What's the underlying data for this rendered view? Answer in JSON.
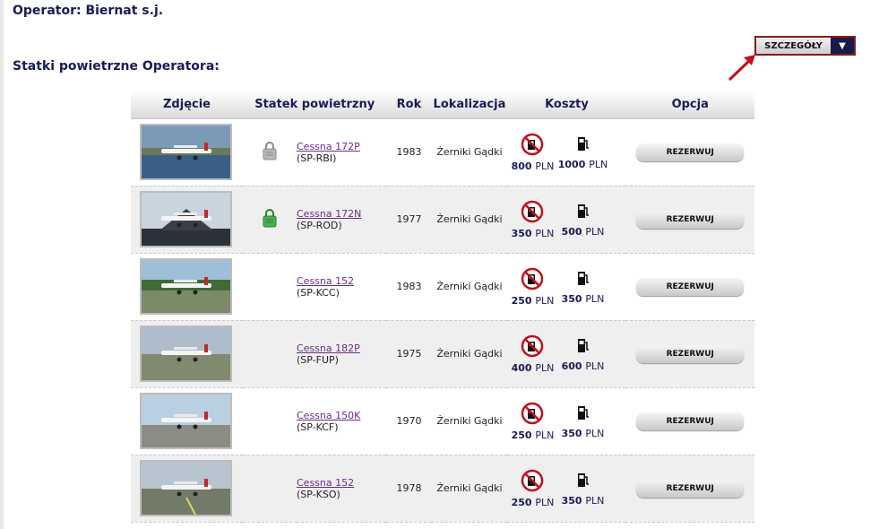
{
  "operator_title": "Operator: Biernat s.j.",
  "section_title": "Statki powietrzne Operatora:",
  "details_button": "SZCZEGÓŁY",
  "details_arrow": "▼",
  "headers": [
    "Zdjęcie",
    "Statek powietrzny",
    "Rok",
    "Lokalizacja",
    "Koszty",
    "Opcja"
  ],
  "currency": "PLN",
  "reserve_label": "REZERWUJ",
  "rows": [
    {
      "model": "Cessna 172P",
      "reg": "(SP-RBI)",
      "year": "1983",
      "location": "Żerniki Gądki",
      "cost_dry": "800",
      "cost_wet": "1000",
      "lock": "grey",
      "photo": "seaplane"
    },
    {
      "model": "Cessna 172N",
      "reg": "(SP-ROD)",
      "year": "1977",
      "location": "Żerniki Gądki",
      "cost_dry": "350",
      "cost_wet": "500",
      "lock": "green",
      "photo": "hangar"
    },
    {
      "model": "Cessna 152",
      "reg": "(SP-KCC)",
      "year": "1983",
      "location": "Żerniki Gądki",
      "cost_dry": "250",
      "cost_wet": "350",
      "lock": "none",
      "photo": "front"
    },
    {
      "model": "Cessna 182P",
      "reg": "(SP-FUP)",
      "year": "1975",
      "location": "Żerniki Gądki",
      "cost_dry": "400",
      "cost_wet": "600",
      "lock": "none",
      "photo": "side"
    },
    {
      "model": "Cessna 150K",
      "reg": "(SP-KCF)",
      "year": "1970",
      "location": "Żerniki Gądki",
      "cost_dry": "250",
      "cost_wet": "350",
      "lock": "none",
      "photo": "front2"
    },
    {
      "model": "Cessna 152",
      "reg": "(SP-KSO)",
      "year": "1978",
      "location": "Żerniki Gądki",
      "cost_dry": "250",
      "cost_wet": "350",
      "lock": "none",
      "photo": "runway"
    }
  ]
}
